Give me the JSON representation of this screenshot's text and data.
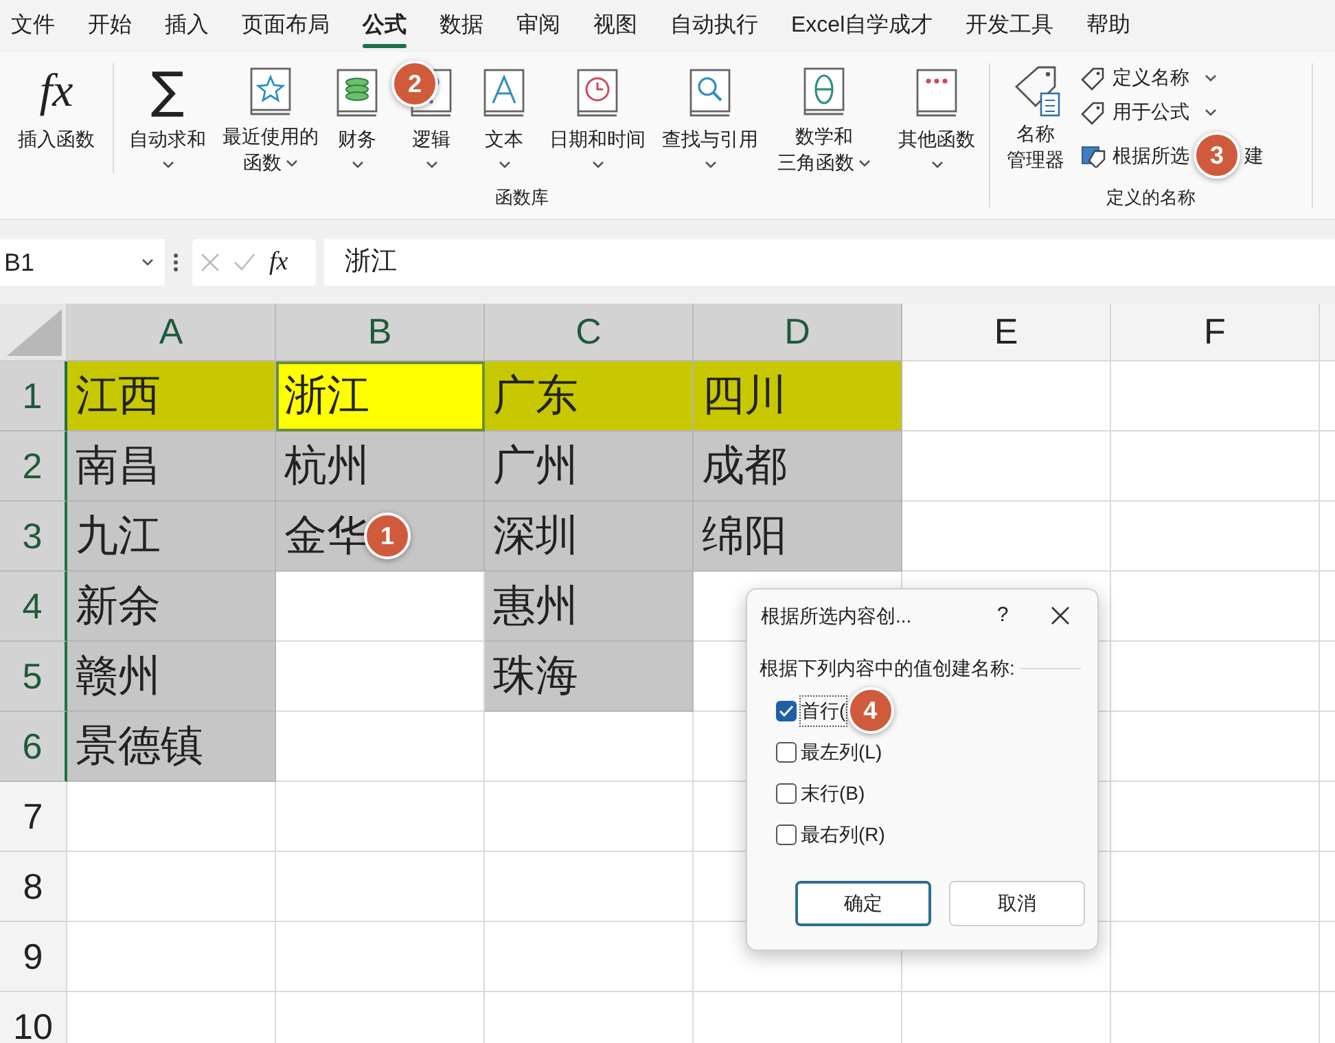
{
  "menu_tabs": [
    {
      "label": "文件",
      "selected": false
    },
    {
      "label": "开始",
      "selected": false
    },
    {
      "label": "插入",
      "selected": false
    },
    {
      "label": "页面布局",
      "selected": false
    },
    {
      "label": "公式",
      "selected": true
    },
    {
      "label": "数据",
      "selected": false
    },
    {
      "label": "审阅",
      "selected": false
    },
    {
      "label": "视图",
      "selected": false
    },
    {
      "label": "自动执行",
      "selected": false
    },
    {
      "label": "Excel自学成才",
      "selected": false
    },
    {
      "label": "开发工具",
      "selected": false
    },
    {
      "label": "帮助",
      "selected": false
    }
  ],
  "function_library": {
    "label": "函数库",
    "items": [
      {
        "lines": [
          "插入函数"
        ],
        "glyph": "fx",
        "dropdown": false
      },
      {
        "lines": [
          "自动求和"
        ],
        "glyph": "∑",
        "dropdown": true
      },
      {
        "lines": [
          "最近使用的",
          "函数"
        ],
        "dropdown": true
      },
      {
        "lines": [
          "财务"
        ],
        "dropdown": true
      },
      {
        "lines": [
          "逻辑"
        ],
        "dropdown": true,
        "callout": "2"
      },
      {
        "lines": [
          "文本"
        ],
        "dropdown": true
      },
      {
        "lines": [
          "日期和时间"
        ],
        "dropdown": true
      },
      {
        "lines": [
          "查找与引用"
        ],
        "dropdown": true
      },
      {
        "lines": [
          "数学和",
          "三角函数"
        ],
        "dropdown": true
      },
      {
        "lines": [
          "其他函数"
        ],
        "dropdown": true
      }
    ]
  },
  "defined_names": {
    "label": "定义的名称",
    "manager": {
      "lines": [
        "名称",
        "管理器"
      ]
    },
    "items": [
      {
        "parts": [
          "定义名称"
        ],
        "dropdown": true
      },
      {
        "parts": [
          "用于公式"
        ],
        "dropdown": true
      },
      {
        "parts": [
          "根据所选",
          "建"
        ],
        "dropdown": false,
        "callout": "3"
      }
    ]
  },
  "formula_bar": {
    "name_box": "B1",
    "fx": "fx",
    "value": "浙江"
  },
  "sheet": {
    "columns": [
      {
        "label": "A",
        "highlighted": true
      },
      {
        "label": "B",
        "highlighted": true
      },
      {
        "label": "C",
        "highlighted": true
      },
      {
        "label": "D",
        "highlighted": true
      },
      {
        "label": "E",
        "highlighted": false
      },
      {
        "label": "F",
        "highlighted": false
      }
    ],
    "rows": [
      {
        "header": "1",
        "highlighted": true,
        "cells": [
          {
            "text": "江西",
            "color": "#c8c800",
            "selected": false
          },
          {
            "text": "浙江",
            "color": "#ffff00",
            "selected": true
          },
          {
            "text": "广东",
            "color": "#c8c800",
            "selected": false
          },
          {
            "text": "四川",
            "color": "#c8c800",
            "selected": false
          },
          {
            "selected": false
          },
          {
            "selected": false
          }
        ]
      },
      {
        "header": "2",
        "highlighted": true,
        "cells": [
          {
            "text": "南昌",
            "color": "#c6c6c6",
            "selected": false
          },
          {
            "text": "杭州",
            "color": "#c6c6c6",
            "selected": false
          },
          {
            "text": "广州",
            "color": "#c6c6c6",
            "selected": false
          },
          {
            "text": "成都",
            "color": "#c6c6c6",
            "selected": false
          },
          {
            "selected": false
          },
          {
            "selected": false
          }
        ]
      },
      {
        "header": "3",
        "highlighted": true,
        "cells": [
          {
            "text": "九江",
            "color": "#c6c6c6",
            "selected": false
          },
          {
            "text": "金华",
            "color": "#c6c6c6",
            "selected": false,
            "callout": "1"
          },
          {
            "text": "深圳",
            "color": "#c6c6c6",
            "selected": false
          },
          {
            "text": "绵阳",
            "color": "#c6c6c6",
            "selected": false
          },
          {
            "selected": false
          },
          {
            "selected": false
          }
        ]
      },
      {
        "header": "4",
        "highlighted": true,
        "cells": [
          {
            "text": "新余",
            "color": "#c6c6c6",
            "selected": false
          },
          {
            "selected": false
          },
          {
            "text": "惠州",
            "color": "#c6c6c6",
            "selected": false
          },
          {
            "selected": false
          },
          {
            "selected": false
          },
          {
            "selected": false
          }
        ]
      },
      {
        "header": "5",
        "highlighted": true,
        "cells": [
          {
            "text": "赣州",
            "color": "#c6c6c6",
            "selected": false
          },
          {
            "selected": false
          },
          {
            "text": "珠海",
            "color": "#c6c6c6",
            "selected": false
          },
          {
            "selected": false
          },
          {
            "selected": false
          },
          {
            "selected": false
          }
        ]
      },
      {
        "header": "6",
        "highlighted": true,
        "cells": [
          {
            "text": "景德镇",
            "color": "#c6c6c6",
            "selected": false
          },
          {
            "selected": false
          },
          {
            "selected": false
          },
          {
            "selected": false
          },
          {
            "selected": false
          },
          {
            "selected": false
          }
        ]
      },
      {
        "header": "7",
        "highlighted": false,
        "cells": []
      },
      {
        "header": "8",
        "highlighted": false,
        "cells": []
      },
      {
        "header": "9",
        "highlighted": false,
        "cells": []
      },
      {
        "header": "10",
        "highlighted": false,
        "cells": []
      }
    ]
  },
  "dialog": {
    "title": "根据所选内容创...",
    "help": "?",
    "prompt": "根据下列内容中的值创建名称:",
    "options": [
      {
        "label": "首行(",
        "checked": true,
        "callout": "4"
      },
      {
        "label": "最左列(L)",
        "checked": false
      },
      {
        "label": "末行(B)",
        "checked": false
      },
      {
        "label": "最右列(R)",
        "checked": false
      }
    ],
    "buttons": [
      {
        "label": "确定",
        "default": true
      },
      {
        "label": "取消",
        "default": false
      }
    ]
  }
}
